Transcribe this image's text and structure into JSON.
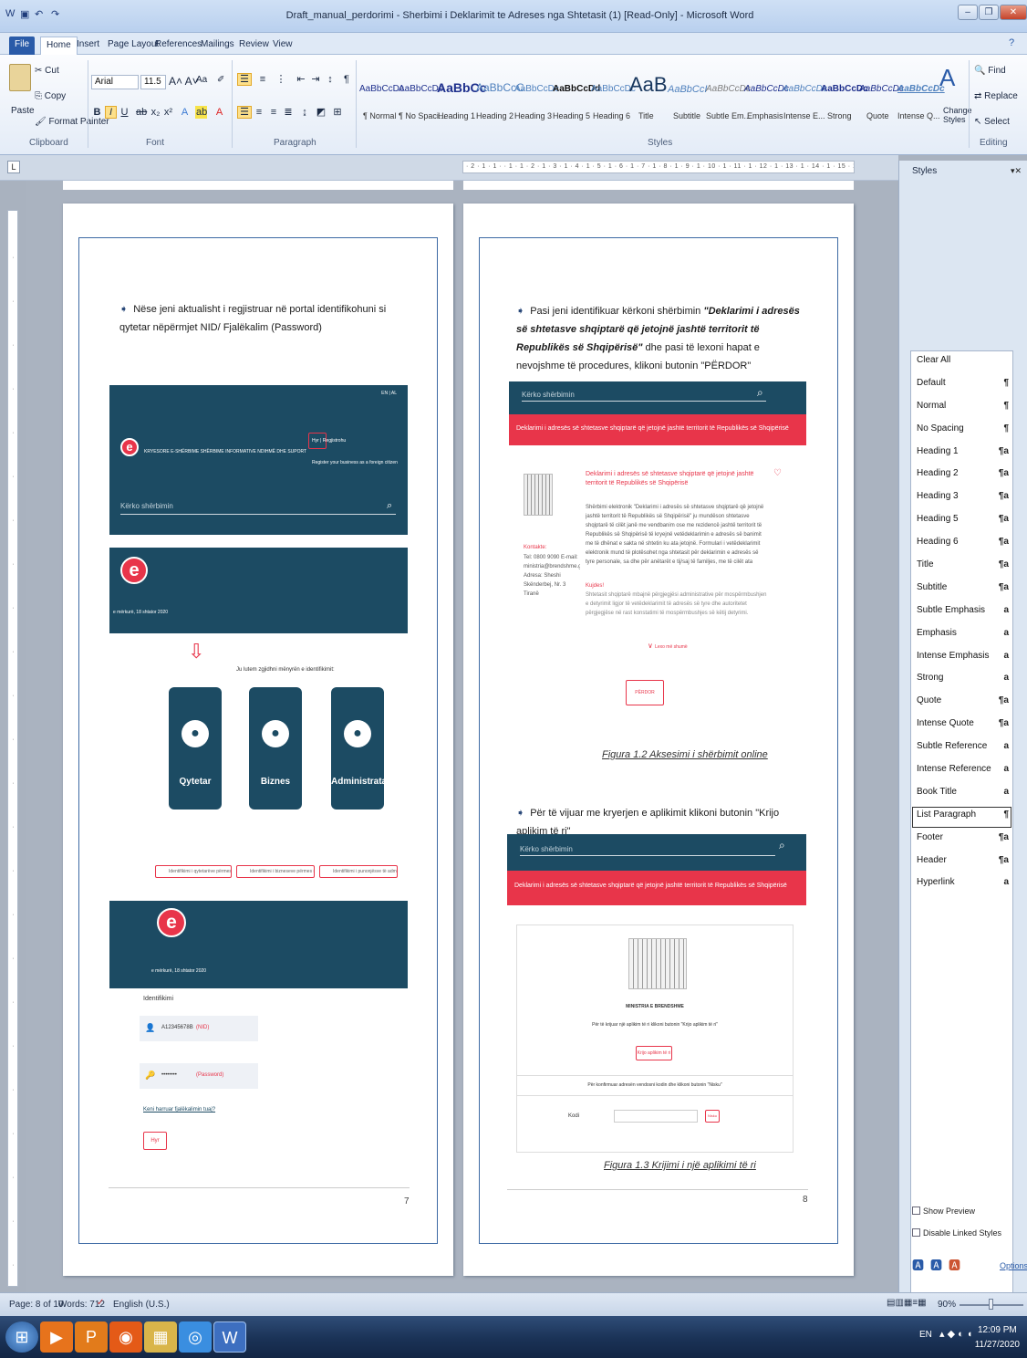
{
  "window": {
    "title": "Draft_manual_perdorimi - Sherbimi i Deklarimit te Adreses nga Shtetasit (1) [Read-Only] - Microsoft Word"
  },
  "tabs": [
    "File",
    "Home",
    "Insert",
    "Page Layout",
    "References",
    "Mailings",
    "Review",
    "View"
  ],
  "clipboard": {
    "paste": "Paste",
    "cut": "Cut",
    "copy": "Copy",
    "format_painter": "Format Painter",
    "label": "Clipboard"
  },
  "font": {
    "name": "Arial",
    "size": "11.5",
    "label": "Font"
  },
  "paragraph": {
    "label": "Paragraph"
  },
  "styles": {
    "label": "Styles",
    "change_styles": "Change Styles",
    "gallery": [
      {
        "preview": "AaBbCcDc",
        "name": "¶ Normal"
      },
      {
        "preview": "AaBbCcDc",
        "name": "¶ No Spaci..."
      },
      {
        "preview": "AaBbCc",
        "name": "Heading 1"
      },
      {
        "preview": "AaBbCcC",
        "name": "Heading 2"
      },
      {
        "preview": "AaBbCcDc",
        "name": "Heading 3"
      },
      {
        "preview": "AaBbCcDd",
        "name": "Heading 5"
      },
      {
        "preview": "AaBbCcDc",
        "name": "Heading 6"
      },
      {
        "preview": "AaB",
        "name": "Title"
      },
      {
        "preview": "AaBbCcI",
        "name": "Subtitle"
      },
      {
        "preview": "AaBbCcDc",
        "name": "Subtle Em..."
      },
      {
        "preview": "AaBbCcDc",
        "name": "Emphasis"
      },
      {
        "preview": "AaBbCcDc",
        "name": "Intense E..."
      },
      {
        "preview": "AaBbCcDc",
        "name": "Strong"
      },
      {
        "preview": "AaBbCcDc",
        "name": "Quote"
      },
      {
        "preview": "AaBbCcDc",
        "name": "Intense Q..."
      }
    ]
  },
  "editing": {
    "find": "Find",
    "replace": "Replace",
    "select": "Select",
    "label": "Editing"
  },
  "ruler": {
    "marks": "· 2 · 1 · 1 · · 1 · 1 · 2 · 1 · 3 · 1 · 4 · 1 · 5 · 1 · 6 · 1 · 7 · 1 · 8 · 1 · 9 · 1 · 10 · 1 · 11 · 1 · 12 · 1 · 13 · 1 · 14 · 1 · 15 · 1 · 16 · 1 · 17 · 1 · 18 · 1 · 19"
  },
  "page7": {
    "bullet": "Nëse jeni aktualisht i regjistruar në portal identifikohuni si qytetar nëpërmjet NID/ Fjalëkalim (Password)",
    "portal": {
      "lang": "EN | AL",
      "nav": "KRYESORE  E-SHËRBIME  SHËRBIME INFORMATIVE  NDIHMË DHE SUPORT",
      "login": "Hyr | Regjistrohu",
      "register_note": "Register your business as a foreign citizen",
      "search": "Kërko shërbimin",
      "date": "e mërkurë, 18 shtator 2020",
      "choose": "Ju lutem zgjidhni mënyrën e identifikimit:"
    },
    "tiles": [
      "Qytetar",
      "Biznes",
      "Administrata"
    ],
    "id_buttons": [
      "Identifikimi i qytetarëve përmes NID",
      "Identifikimi i bizneseve përmes nënçertifikatës",
      "Identifikimi i punonjësve të administratës shtetërore"
    ],
    "login": {
      "date": "e mërkurë, 18 shtator 2020",
      "heading": "Identifikimi",
      "nid_value": "A12345678B",
      "nid_hint": "(NID)",
      "pwd_value": "••••••••",
      "pwd_hint": "(Password)",
      "forgot": "Keni harruar fjalëkalimin tuaj?",
      "submit": "Hyr"
    },
    "page_number": "7"
  },
  "page8": {
    "bullet1_a": "Pasi jeni identifikuar kërkoni shërbimin ",
    "bullet1_b": "\"Deklarimi i adresës së shtetasve shqiptarë që jetojnë jashtë territorit të Republikës së Shqipërisë\"",
    "bullet1_c": " dhe pasi të lexoni hapat e nevojshme të procedures, klikoni butonin \"PËRDOR\"",
    "search": "Kërko shërbimin",
    "banner": "Deklarimi i adresës së shtetasve shqiptarë që jetojnë jashtë territorit të Republikës së Shqipërisë",
    "service_title": "Deklarimi i adresës së shtetasve shqiptarë që jetojnë jashtë territorit të Republikës së Shqipërisë",
    "service_desc": "Shërbimi elektronik \"Deklarimi i adresës së shtetasve shqiptarë që jetojnë jashtë territorit të Republikës së Shqipërisë\" ju mundëson shtetasve shqiptarë të cilët janë me vendbanim ose me rezidencë jashtë territorit të Republikës së Shqipërisë të kryejnë vetëdeklarimin e adresës së banimit me të dhënat e sakta në shtetin ku ata jetojnë. Formulari i vetëdeklarimit elektronik mund të plotësohet nga shtetasit për deklarimin e adresës së tyre personale, sa dhe për anëtarët e tij/saj të familjes, me të cilët ata jetojnë në të njëjtin vendbanim me deklaruesin.",
    "contact_label": "Kontakte:",
    "contact": "Tel: 0800 9090  E-mail: ministria@brendshme.gov.al  Adresa: Sheshi Skënderbej, Nr. 3 Tiranë",
    "note_label": "Kujdes!",
    "note": "Shtetasit shqiptarë mbajnë përgjegjësi administrative për mospërmbushjen e detyrimit ligjor të vetëdeklarimit të adresës së tyre dhe autoritetet përgjegjëse në rast konstatimi të mospërmbushjes së këtij detyrimi.",
    "readmore": "Lexo më shumë",
    "use_button": "PËRDOR",
    "caption1": "Figura 1.2 Aksesimi i shërbimit online",
    "bullet2": "Për të vijuar me kryerjen e aplikimit klikoni butonin \"Krijo aplikim të ri\"",
    "ministry": "MINISTRIA E BRENDSHME",
    "instr1": "Për të krijuar një aplikim të ri klikoni butonin \"Krijo aplikim të ri\"",
    "create_button": "Krijo aplikim të ri",
    "instr2": "Për konfirmuar adresën vendosni kodin dhe klikoni butonin \"Nisku\"",
    "code_label": "Kodi",
    "confirm_button": "Nisku",
    "caption2": "Figura 1.3 Krijimi i një aplikimi të ri",
    "page_number": "8"
  },
  "styles_pane": {
    "title": "Styles",
    "items": [
      {
        "name": "Clear All",
        "sym": ""
      },
      {
        "name": "Default",
        "sym": "¶"
      },
      {
        "name": "Normal",
        "sym": "¶"
      },
      {
        "name": "No Spacing",
        "sym": "¶"
      },
      {
        "name": "Heading 1",
        "sym": "¶a"
      },
      {
        "name": "Heading 2",
        "sym": "¶a"
      },
      {
        "name": "Heading 3",
        "sym": "¶a"
      },
      {
        "name": "Heading 5",
        "sym": "¶a"
      },
      {
        "name": "Heading 6",
        "sym": "¶a"
      },
      {
        "name": "Title",
        "sym": "¶a"
      },
      {
        "name": "Subtitle",
        "sym": "¶a"
      },
      {
        "name": "Subtle Emphasis",
        "sym": "a"
      },
      {
        "name": "Emphasis",
        "sym": "a"
      },
      {
        "name": "Intense Emphasis",
        "sym": "a"
      },
      {
        "name": "Strong",
        "sym": "a"
      },
      {
        "name": "Quote",
        "sym": "¶a"
      },
      {
        "name": "Intense Quote",
        "sym": "¶a"
      },
      {
        "name": "Subtle Reference",
        "sym": "a"
      },
      {
        "name": "Intense Reference",
        "sym": "a"
      },
      {
        "name": "Book Title",
        "sym": "a"
      },
      {
        "name": "List Paragraph",
        "sym": "¶"
      },
      {
        "name": "Footer",
        "sym": "¶a"
      },
      {
        "name": "Header",
        "sym": "¶a"
      },
      {
        "name": "Hyperlink",
        "sym": "a"
      }
    ],
    "selected": "List Paragraph",
    "show_preview": "Show Preview",
    "disable_linked": "Disable Linked Styles",
    "options": "Options..."
  },
  "status": {
    "page": "Page: 8 of 10",
    "words": "Words: 712",
    "language": "English (U.S.)",
    "zoom": "90%"
  },
  "taskbar": {
    "lang": "EN",
    "time": "12:09 PM",
    "date": "11/27/2020"
  }
}
